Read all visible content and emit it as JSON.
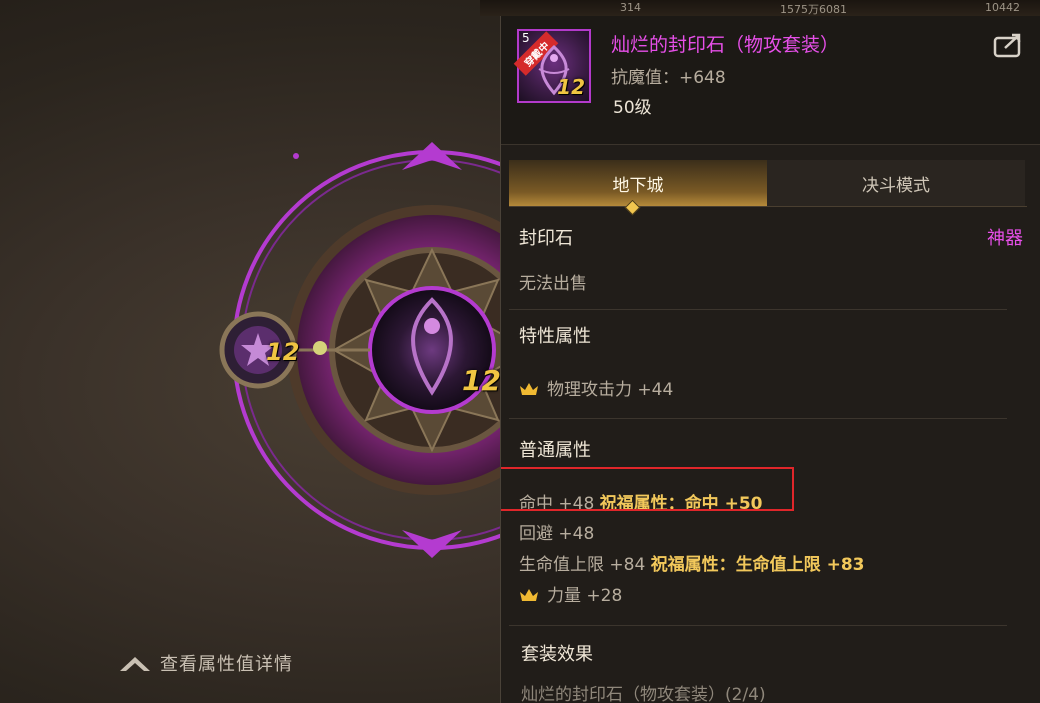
{
  "topbar": {
    "v1": "314",
    "v2": "1575万6081",
    "v3": "10442"
  },
  "scene": {
    "badge_small": "12",
    "badge_main": "12",
    "detail_link": "查看属性值详情"
  },
  "item": {
    "level_tag": "5",
    "equipped_flag": "穿戴中",
    "icon_number": "12",
    "name": "灿烂的封印石（物攻套装）",
    "resist": "抗魔值：+648",
    "level": "50级",
    "name_color": "#e64fe8"
  },
  "tabs": [
    {
      "label": "地下城",
      "active": true
    },
    {
      "label": "决斗模式",
      "active": false
    }
  ],
  "category": {
    "label": "封印石",
    "rarity": "神器"
  },
  "trade": "无法出售",
  "special": {
    "title": "特性属性",
    "stats": [
      {
        "text": "物理攻击力 +44",
        "icon": "crown-icon"
      }
    ]
  },
  "normal": {
    "title": "普通属性",
    "stats": [
      {
        "text": "命中 +48",
        "bless_label": "祝福属性：",
        "bless_value": "命中 +50"
      },
      {
        "text": "回避 +48"
      },
      {
        "text": "生命值上限 +84",
        "bless_label": "祝福属性：",
        "bless_value": "生命值上限 +83"
      },
      {
        "text": "力量 +28",
        "icon": "crown-icon"
      }
    ]
  },
  "set": {
    "title": "套装效果",
    "subtitle": "灿烂的封印石（物攻套装）(2/4)"
  }
}
